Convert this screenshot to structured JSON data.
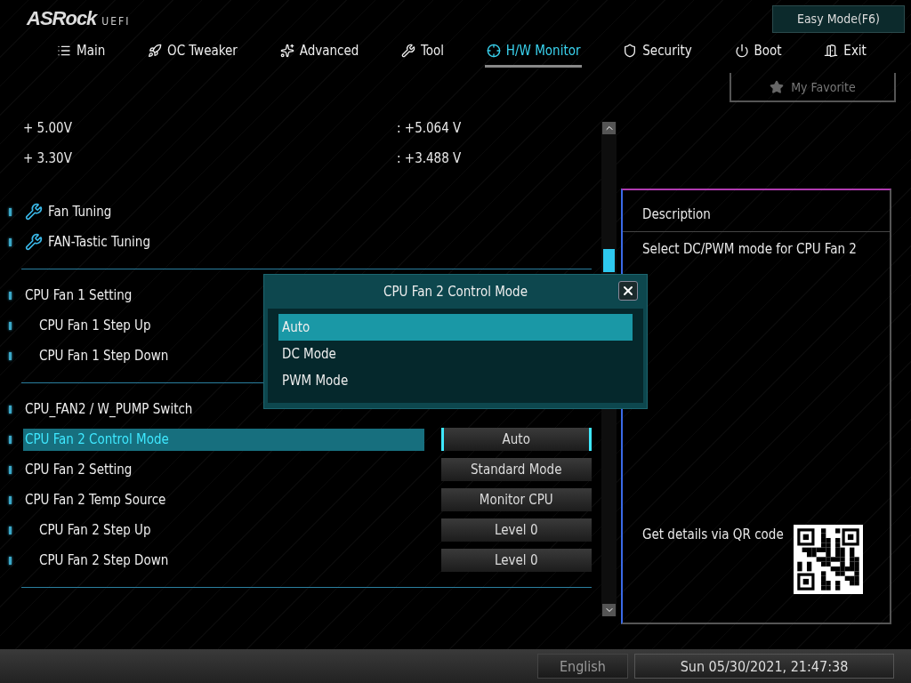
{
  "header": {
    "logo": "ASRock",
    "logo_suffix": "UEFI",
    "mode_button": "Easy Mode(F6)"
  },
  "tabs": [
    {
      "label": "Main",
      "selected": false
    },
    {
      "label": "OC Tweaker",
      "selected": false
    },
    {
      "label": "Advanced",
      "selected": false
    },
    {
      "label": "Tool",
      "selected": false
    },
    {
      "label": "H/W Monitor",
      "selected": true
    },
    {
      "label": "Security",
      "selected": false
    },
    {
      "label": "Boot",
      "selected": false
    },
    {
      "label": "Exit",
      "selected": false
    }
  ],
  "favorite_button": "My Favorite",
  "items": [
    {
      "kind": "voltage",
      "label": "+ 5.00V",
      "value": ": +5.064 V"
    },
    {
      "kind": "voltage",
      "label": "+ 3.30V",
      "value": ": +3.488 V"
    },
    {
      "kind": "divider",
      "line": false
    },
    {
      "kind": "submenu",
      "label": "Fan Tuning"
    },
    {
      "kind": "submenu",
      "label": "FAN-Tastic Tuning"
    },
    {
      "kind": "divider",
      "line": true
    },
    {
      "kind": "setting",
      "label": "CPU Fan 1 Setting",
      "selected": false,
      "children": [
        {
          "label": "CPU Fan 1 Step Up",
          "selected": false
        },
        {
          "label": "CPU Fan 1 Step Down",
          "selected": false
        }
      ]
    },
    {
      "kind": "divider",
      "line": true
    },
    {
      "kind": "setting",
      "label": "CPU_FAN2 / W_PUMP Switch",
      "selected": false
    },
    {
      "kind": "setting",
      "label": "CPU Fan 2 Control Mode",
      "value": "Auto",
      "selected": true
    },
    {
      "kind": "setting",
      "label": "CPU Fan 2 Setting",
      "value": "Standard Mode",
      "selected": false
    },
    {
      "kind": "setting",
      "label": "CPU Fan 2 Temp Source",
      "value": "Monitor CPU",
      "selected": false,
      "children": [
        {
          "label": "CPU Fan 2 Step Up",
          "value": "Level 0",
          "selected": false
        },
        {
          "label": "CPU Fan 2 Step Down",
          "value": "Level 0",
          "selected": false
        }
      ]
    },
    {
      "kind": "divider",
      "line": true
    }
  ],
  "description": {
    "title": "Description",
    "text": "Select DC/PWM mode for CPU Fan 2",
    "qr_text": "Get details via QR code"
  },
  "dialog": {
    "title": "CPU Fan 2 Control Mode",
    "options": [
      {
        "label": "Auto",
        "selected": true
      },
      {
        "label": "DC Mode",
        "selected": false
      },
      {
        "label": "PWM Mode",
        "selected": false
      }
    ]
  },
  "status_bar": {
    "language": "English",
    "datetime": "Sun 05/30/2021, 21:47:38"
  }
}
